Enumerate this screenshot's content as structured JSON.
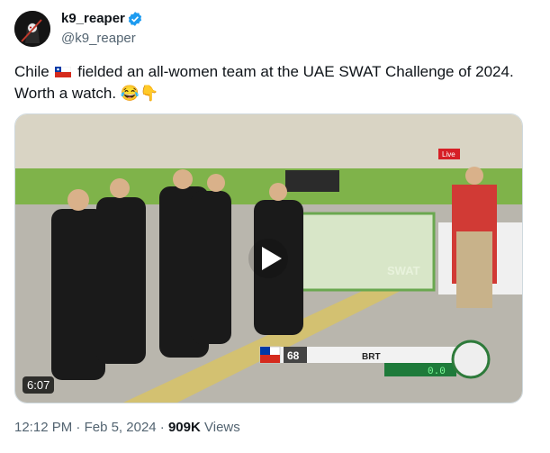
{
  "author": {
    "name": "k9_reaper",
    "handle": "@k9_reaper",
    "verified_icon": "verified-badge-icon",
    "brand_color": "#1d9bf0"
  },
  "tweet": {
    "text_part1": "Chile",
    "text_part2": "fielded an all-women team at the UAE SWAT Challenge of 2024. Worth a watch.",
    "emoji": "😂👇"
  },
  "video": {
    "duration": "6:07",
    "overlay_score": "68",
    "overlay_team": "BRT",
    "overlay_timer": "0.0",
    "banner_text": "SWAT",
    "live_label": "Live"
  },
  "meta": {
    "time": "12:12 PM",
    "date": "Feb 5, 2024",
    "views_count": "909K",
    "views_label": "Views"
  }
}
